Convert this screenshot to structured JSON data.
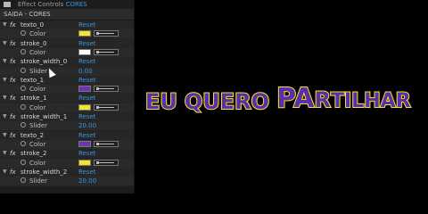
{
  "panel": {
    "top_bar_text_prefix": "Effect Controls",
    "top_bar_text_accent": "CORES",
    "header": "SAIDA - CORES"
  },
  "rows": [
    {
      "kind": "effect",
      "name": "texto_0",
      "reset": "Reset"
    },
    {
      "kind": "color",
      "name": "Color",
      "color": "#f4e52c"
    },
    {
      "kind": "effect",
      "name": "stroke_0",
      "reset": "Reset"
    },
    {
      "kind": "color",
      "name": "Color",
      "color": "#ffffff"
    },
    {
      "kind": "effect",
      "name": "stroke_width_0",
      "reset": "Reset"
    },
    {
      "kind": "slider",
      "name": "Slider",
      "value": "0.00"
    },
    {
      "kind": "effect",
      "name": "texto_1",
      "reset": "Reset"
    },
    {
      "kind": "color",
      "name": "Color",
      "color": "#6a35b8"
    },
    {
      "kind": "effect",
      "name": "stroke_1",
      "reset": "Reset"
    },
    {
      "kind": "color",
      "name": "Color",
      "color": "#f4e52c"
    },
    {
      "kind": "effect",
      "name": "stroke_width_1",
      "reset": "Reset"
    },
    {
      "kind": "slider",
      "name": "Slider",
      "value": "20.00"
    },
    {
      "kind": "effect",
      "name": "texto_2",
      "reset": "Reset"
    },
    {
      "kind": "color",
      "name": "Color",
      "color": "#6a35b8"
    },
    {
      "kind": "effect",
      "name": "stroke_2",
      "reset": "Reset"
    },
    {
      "kind": "color",
      "name": "Color",
      "color": "#f4e52c"
    },
    {
      "kind": "effect",
      "name": "stroke_width_2",
      "reset": "Reset"
    },
    {
      "kind": "slider",
      "name": "Slider",
      "value": "20.00"
    }
  ],
  "viewer": {
    "words": [
      {
        "text": "EU"
      },
      {
        "text": "QUERO"
      },
      {
        "text": "PARTILHAR"
      }
    ],
    "fill_color": "#5b2fa8",
    "stroke_color": "#f4e52c"
  }
}
